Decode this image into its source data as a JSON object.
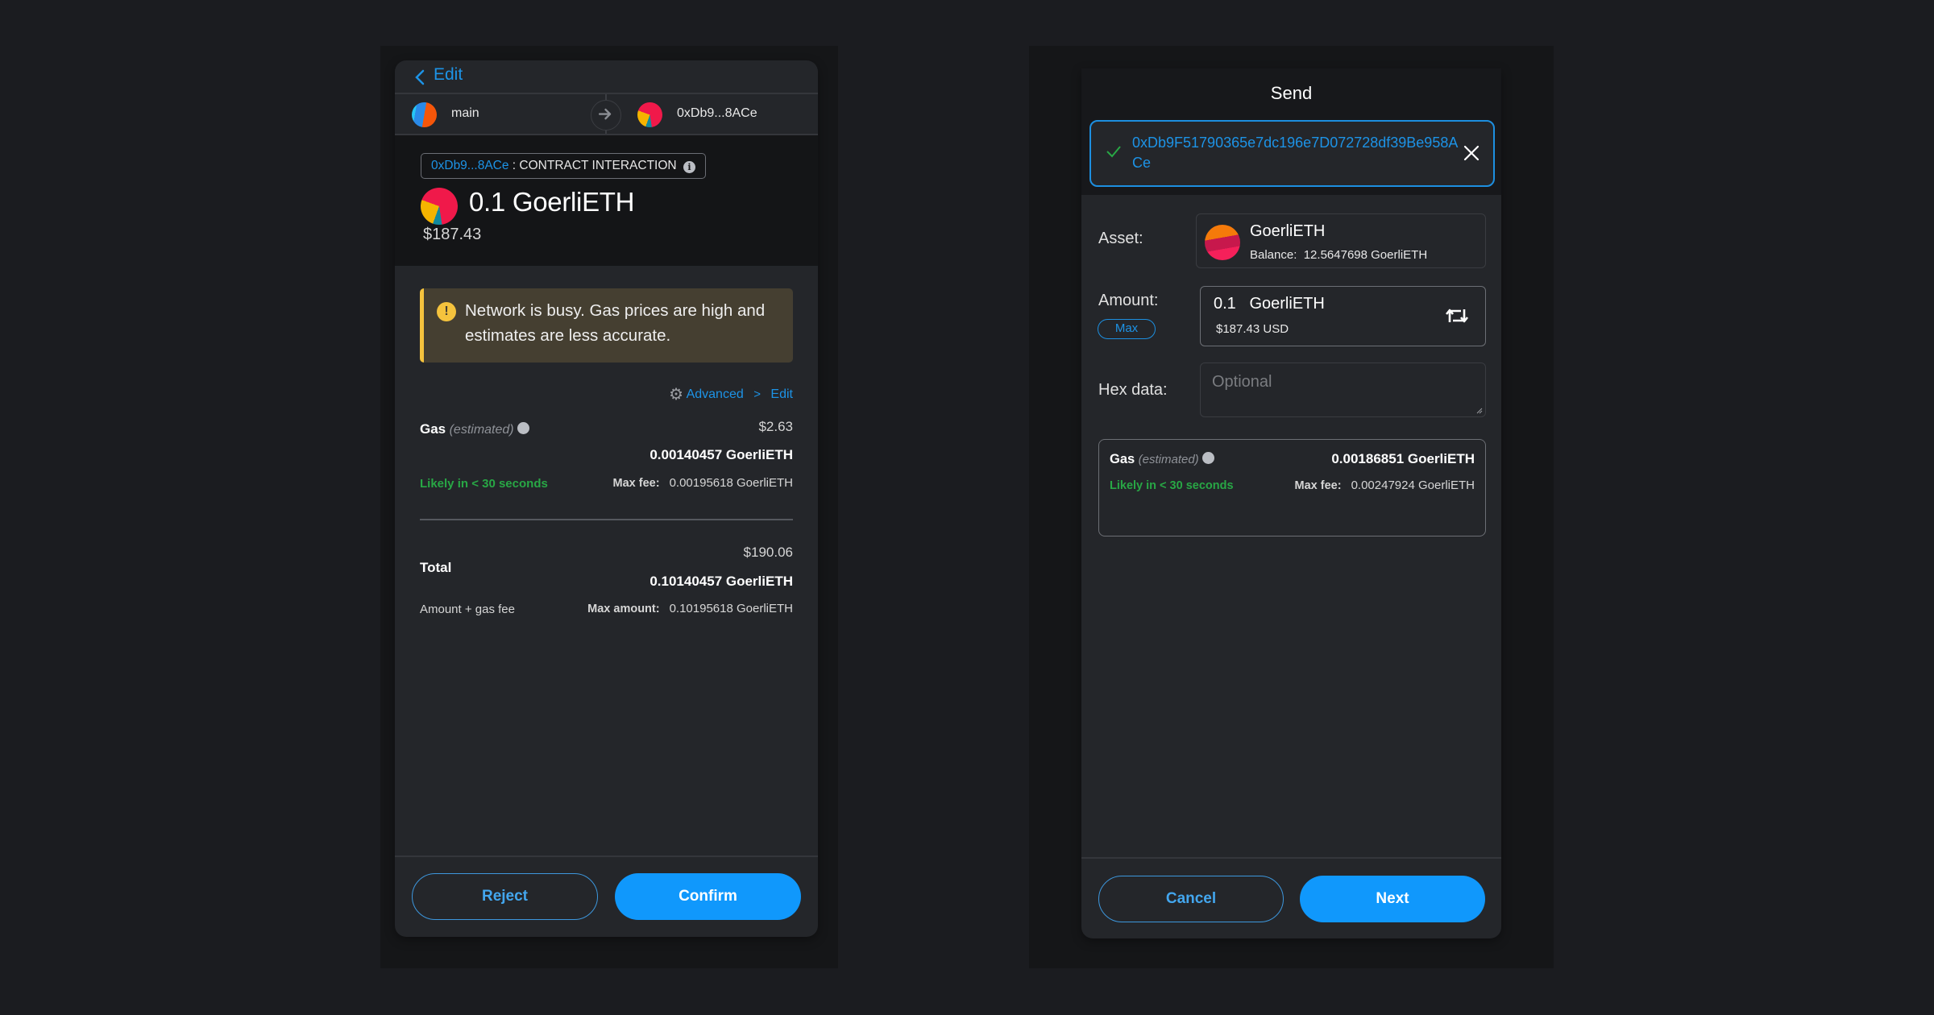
{
  "confirm_panel": {
    "back_label": "Edit",
    "from_account": "main",
    "to_account": "0xDb9...8ACe",
    "contract_address": "0xDb9...8ACe",
    "contract_separator": " : ",
    "contract_label": "CONTRACT INTERACTION",
    "amount": "0.1 GoerliETH",
    "amount_fiat": "$187.43",
    "warning": "Network is busy. Gas prices are high and estimates are less accurate.",
    "advanced_label": "Advanced",
    "edit_label": "Edit",
    "gas": {
      "label": "Gas",
      "sub_label": "(estimated)",
      "fiat": "$2.63",
      "amount": "0.00140457 GoerliETH",
      "speed": "Likely in < 30 seconds",
      "max_fee_label": "Max fee:",
      "max_fee_value": "0.00195618 GoerliETH"
    },
    "total": {
      "label": "Total",
      "fiat": "$190.06",
      "amount": "0.10140457 GoerliETH",
      "sub_label": "Amount + gas fee",
      "max_amount_label": "Max amount:",
      "max_amount_value": "0.10195618 GoerliETH"
    },
    "reject_label": "Reject",
    "confirm_label": "Confirm"
  },
  "send_panel": {
    "title": "Send",
    "recipient_address": "0xDb9F51790365e7dc196e7D072728df39Be958ACe",
    "asset_label": "Asset:",
    "asset_name": "GoerliETH",
    "balance_label": "Balance:",
    "balance_value": "12.5647698 GoerliETH",
    "amount_label": "Amount:",
    "max_label": "Max",
    "amount_value": "0.1   GoerliETH",
    "amount_fiat": "$187.43 USD",
    "hex_label": "Hex data:",
    "hex_placeholder": "Optional",
    "gas": {
      "label": "Gas",
      "sub_label": "(estimated)",
      "amount": "0.00186851 GoerliETH",
      "speed": "Likely in < 30 seconds",
      "max_fee_label": "Max fee:",
      "max_fee_value": "0.00247924 GoerliETH"
    },
    "cancel_label": "Cancel",
    "next_label": "Next"
  },
  "colors": {
    "accent": "#1098fc",
    "link": "#1d93e6",
    "success": "#28a745",
    "warning": "#f5c33d",
    "panel_bg": "#24262a"
  }
}
